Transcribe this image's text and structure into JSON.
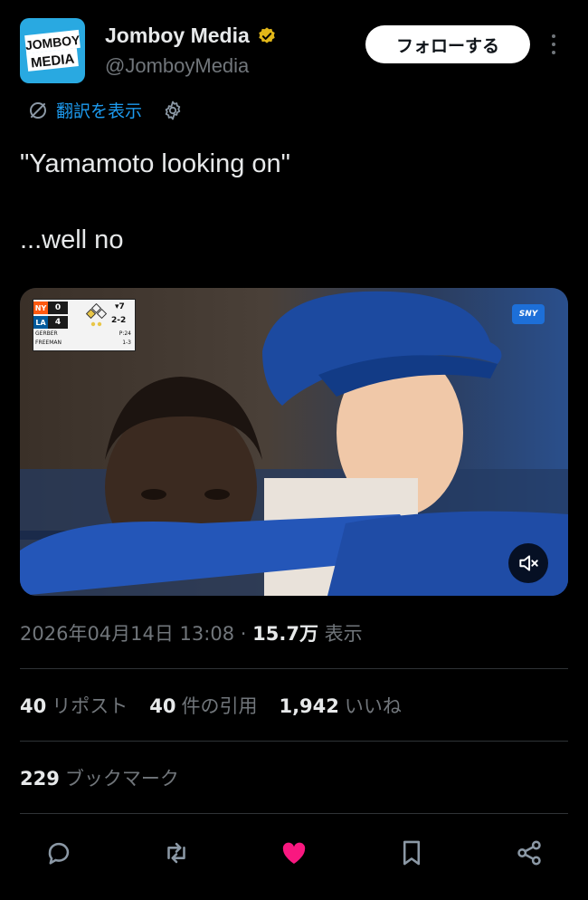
{
  "author": {
    "display_name": "Jomboy Media",
    "handle": "@JomboyMedia",
    "avatar_text_line1": "JOMBOY",
    "avatar_text_line2": "MEDIA",
    "verified_color": "#e2b719"
  },
  "header": {
    "follow_label": "フォローする"
  },
  "translate": {
    "label": "翻訳を表示"
  },
  "tweet": {
    "line1": "\"Yamamoto looking on\"",
    "line2": "...well no"
  },
  "media": {
    "scorebug": {
      "away_team": "NY",
      "away_score": "0",
      "home_team": "LA",
      "home_score": "4",
      "inning": "▾7",
      "count": "2-2",
      "pitcher": "GERBER",
      "pitch_count": "P:24",
      "batter": "FREEMAN",
      "batter_line": "1-3"
    },
    "network_logo": "SNY"
  },
  "meta": {
    "timestamp": "2026年04月14日 13:08",
    "separator": "·",
    "views_count": "15.7万",
    "views_label": "表示"
  },
  "stats": {
    "reposts_count": "40",
    "reposts_label": "リポスト",
    "quotes_count": "40",
    "quotes_label": "件の引用",
    "likes_count": "1,942",
    "likes_label": "いいね",
    "bookmarks_count": "229",
    "bookmarks_label": "ブックマーク"
  },
  "actions": {
    "reply_icon": "reply-icon",
    "retweet_icon": "retweet-icon",
    "like_icon": "heart-icon",
    "bookmark_icon": "bookmark-icon",
    "share_icon": "share-icon",
    "like_color": "#f91880"
  },
  "colors": {
    "accent_link": "#1d9bf0",
    "muted_text": "#71767b",
    "primary_text": "#e7e9ea"
  }
}
